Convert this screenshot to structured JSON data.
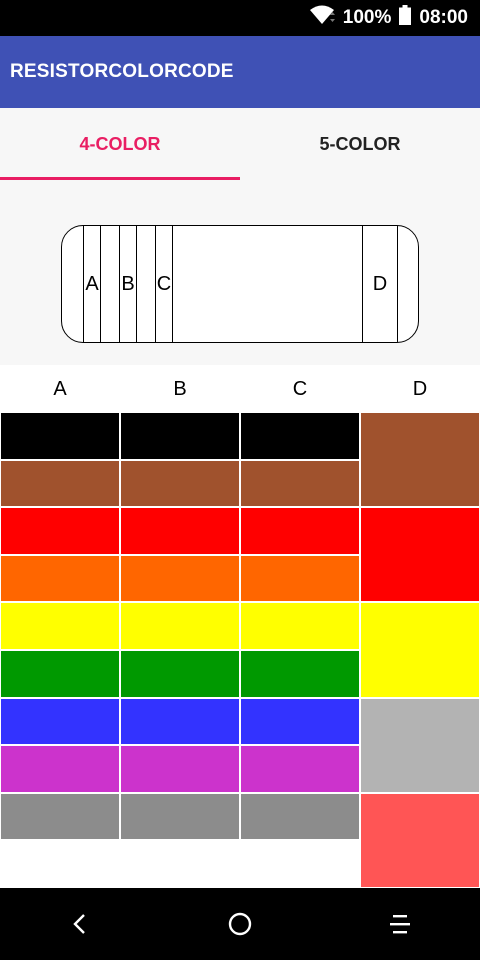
{
  "status": {
    "battery": "100%",
    "time": "08:00"
  },
  "app": {
    "title": "RESISTORCOLORCODE"
  },
  "tabs": [
    {
      "label": "4-COLOR",
      "active": true
    },
    {
      "label": "5-COLOR",
      "active": false
    }
  ],
  "resistor": {
    "bands": {
      "a": "A",
      "b": "B",
      "c": "C",
      "d": "D"
    }
  },
  "columns": {
    "a": "A",
    "b": "B",
    "c": "C",
    "d": "D"
  },
  "palette": {
    "digit_colors": [
      "black",
      "brown",
      "red",
      "orange",
      "yellow",
      "green",
      "blue",
      "violet",
      "gray"
    ],
    "digit_hex": [
      "#000000",
      "#a0522d",
      "#ff0000",
      "#ff6600",
      "#ffff00",
      "#009900",
      "#3333ff",
      "#cc33cc",
      "#8c8c8c"
    ],
    "tolerance_colors": [
      "brown",
      "red",
      "yellow",
      "silver",
      "salmon"
    ],
    "tolerance_hex": [
      "#a0522d",
      "#ff0000",
      "#ffff00",
      "#b3b3b3",
      "#ff5555"
    ]
  },
  "accent": "#e91e63",
  "appbar_color": "#3f51b5",
  "icons": {
    "wifi": "wifi-icon",
    "battery": "battery-icon",
    "back": "back-icon",
    "home": "home-icon",
    "recents": "recents-icon"
  }
}
